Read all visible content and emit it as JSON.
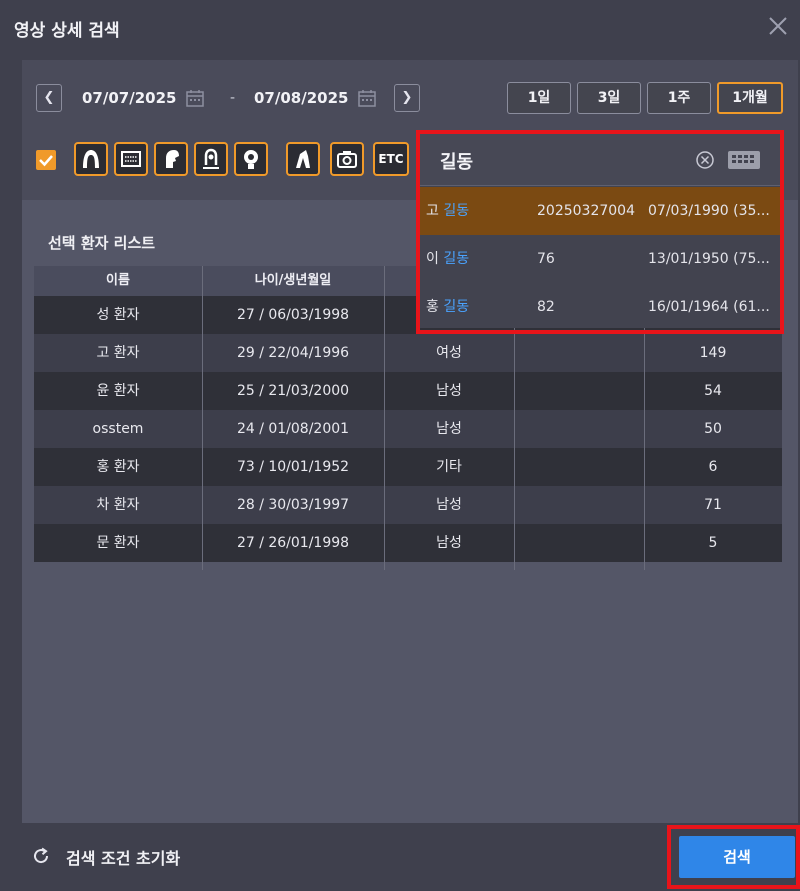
{
  "dialog": {
    "title": "영상 상세 검색"
  },
  "date_range": {
    "start": "07/07/2025",
    "end": "07/08/2025",
    "separator": "-"
  },
  "period_buttons": [
    {
      "label": "1일",
      "active": false
    },
    {
      "label": "3일",
      "active": false
    },
    {
      "label": "1주",
      "active": false
    },
    {
      "label": "1개월",
      "active": true
    }
  ],
  "modalities": {
    "checked": true,
    "icons": [
      "panoramic-icon",
      "intraoral-sensor-icon",
      "ceph-icon",
      "tmj-icon",
      "ct-icon",
      "tooth-model-icon",
      "camera-icon"
    ],
    "etc_label": "ETC"
  },
  "patient_list": {
    "title": "선택 환자 리스트",
    "columns": [
      "이름",
      "나이/생년월일",
      "",
      "",
      ""
    ],
    "rows": [
      {
        "name": "성 환자",
        "age_dob": "27 / 06/03/1998",
        "gender": "",
        "extra": "",
        "count": ""
      },
      {
        "name": "고 환자",
        "age_dob": "29 / 22/04/1996",
        "gender": "여성",
        "extra": "",
        "count": "149"
      },
      {
        "name": "윤 환자",
        "age_dob": "25 / 21/03/2000",
        "gender": "남성",
        "extra": "",
        "count": "54"
      },
      {
        "name": "osstem",
        "age_dob": "24 / 01/08/2001",
        "gender": "남성",
        "extra": "",
        "count": "50"
      },
      {
        "name": "홍 환자",
        "age_dob": "73 / 10/01/1952",
        "gender": "기타",
        "extra": "",
        "count": "6"
      },
      {
        "name": "차 환자",
        "age_dob": "28 / 30/03/1997",
        "gender": "남성",
        "extra": "",
        "count": "71"
      },
      {
        "name": "문 환자",
        "age_dob": "27 / 26/01/1998",
        "gender": "남성",
        "extra": "",
        "count": "5"
      }
    ]
  },
  "search_popup": {
    "query": "길동",
    "results": [
      {
        "prefix": "고",
        "match": "길동",
        "id": "20250327004",
        "dob": "07/03/1990 (35...",
        "selected": true
      },
      {
        "prefix": "이",
        "match": "길동",
        "id": "76",
        "dob": "13/01/1950 (75...",
        "selected": false
      },
      {
        "prefix": "홍",
        "match": "길동",
        "id": "82",
        "dob": "16/01/1964 (61...",
        "selected": false
      }
    ]
  },
  "footer": {
    "reset_label": "검색 조건 초기화",
    "search_label": "검색"
  },
  "colors": {
    "accent": "#f09a2a",
    "primary_button": "#2f86e8",
    "highlight_box": "#e8141a",
    "match_text": "#4aa3ff",
    "selected_row": "#7b4a12"
  }
}
